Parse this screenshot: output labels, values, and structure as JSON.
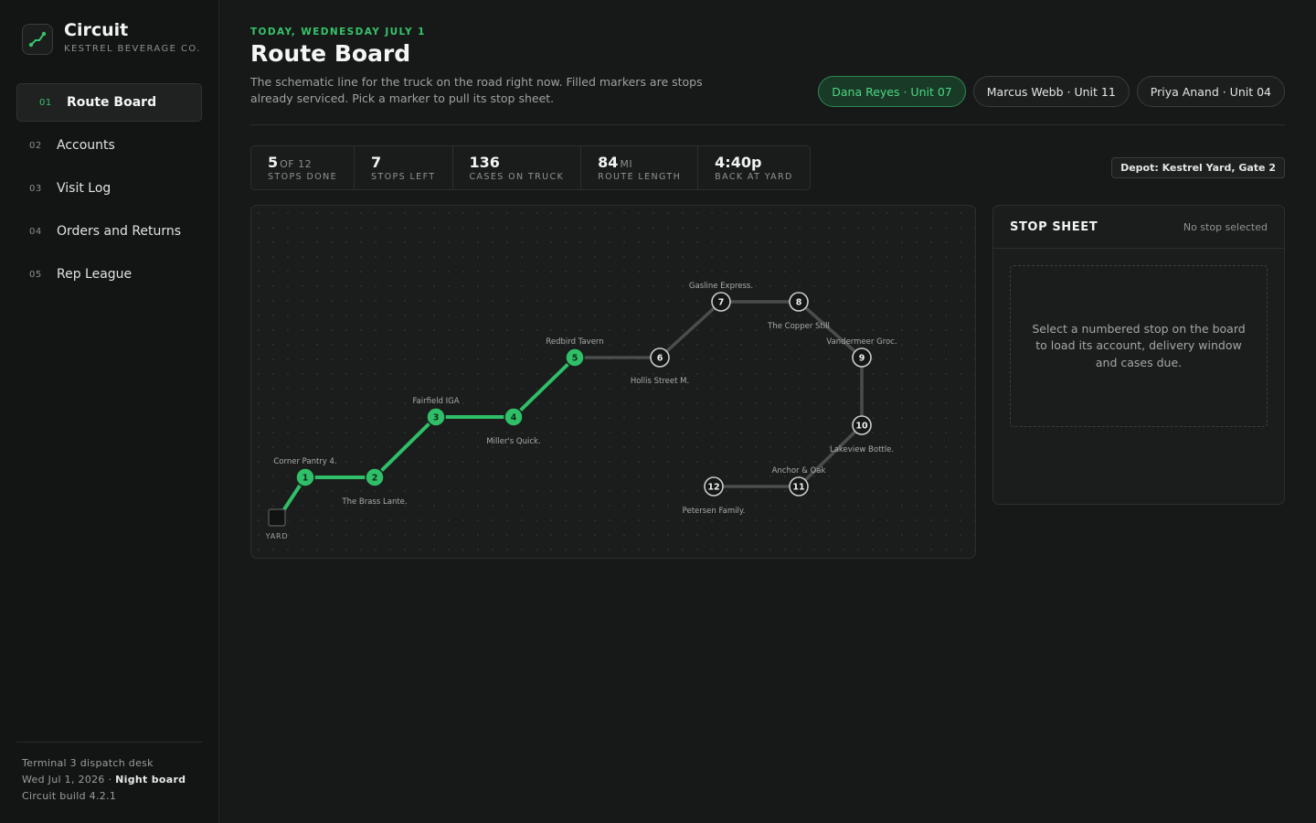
{
  "brand": {
    "name": "Circuit",
    "sub": "KESTREL BEVERAGE CO.",
    "logo_icon": "route-icon"
  },
  "nav": [
    {
      "num": "01",
      "label": "Route Board",
      "active": true
    },
    {
      "num": "02",
      "label": "Accounts"
    },
    {
      "num": "03",
      "label": "Visit Log"
    },
    {
      "num": "04",
      "label": "Orders and Returns"
    },
    {
      "num": "05",
      "label": "Rep League"
    }
  ],
  "footer": {
    "line1": "Terminal 3 dispatch desk",
    "date": "Wed Jul 1, 2026 · ",
    "mode": "Night board",
    "build": "Circuit build 4.2.1"
  },
  "header": {
    "eyebrow": "TODAY, WEDNESDAY JULY 1",
    "title": "Route Board",
    "subtitle": "The schematic line for the truck on the road right now. Filled markers are stops already serviced. Pick a marker to pull its stop sheet."
  },
  "drivers": [
    {
      "label": "Dana Reyes · Unit 07",
      "active": true
    },
    {
      "label": "Marcus Webb · Unit 11"
    },
    {
      "label": "Priya Anand · Unit 04"
    }
  ],
  "stats": [
    {
      "value": "5",
      "unit": "OF 12",
      "label": "STOPS DONE"
    },
    {
      "value": "7",
      "unit": "",
      "label": "STOPS LEFT"
    },
    {
      "value": "136",
      "unit": "",
      "label": "CASES ON TRUCK"
    },
    {
      "value": "84",
      "unit": "MI",
      "label": "ROUTE LENGTH"
    },
    {
      "value": "4:40p",
      "unit": "",
      "label": "BACK AT YARD"
    }
  ],
  "depot": "Depot: Kestrel Yard, Gate 2",
  "board": {
    "yard_label": "YARD",
    "colors": {
      "done": "#2fbf68",
      "pending": "#4a4d4c",
      "accent": "#35c46a"
    },
    "stops": [
      {
        "n": "1",
        "name": "Corner Pantry 4.",
        "done": true
      },
      {
        "n": "2",
        "name": "The Brass Lante.",
        "done": true
      },
      {
        "n": "3",
        "name": "Fairfield IGA",
        "done": true
      },
      {
        "n": "4",
        "name": "Miller's Quick.",
        "done": true
      },
      {
        "n": "5",
        "name": "Redbird Tavern",
        "done": true
      },
      {
        "n": "6",
        "name": "Hollis Street M.",
        "done": false
      },
      {
        "n": "7",
        "name": "Gasline Express.",
        "done": false
      },
      {
        "n": "8",
        "name": "The Copper Still",
        "done": false
      },
      {
        "n": "9",
        "name": "Vandermeer Groc.",
        "done": false
      },
      {
        "n": "10",
        "name": "Lakeview Bottle.",
        "done": false
      },
      {
        "n": "11",
        "name": "Anchor & Oak",
        "done": false
      },
      {
        "n": "12",
        "name": "Petersen Family.",
        "done": false
      }
    ]
  },
  "sheet": {
    "title": "STOP SHEET",
    "status": "No stop selected",
    "empty": "Select a numbered stop on the board to load its account, delivery window and cases due."
  }
}
